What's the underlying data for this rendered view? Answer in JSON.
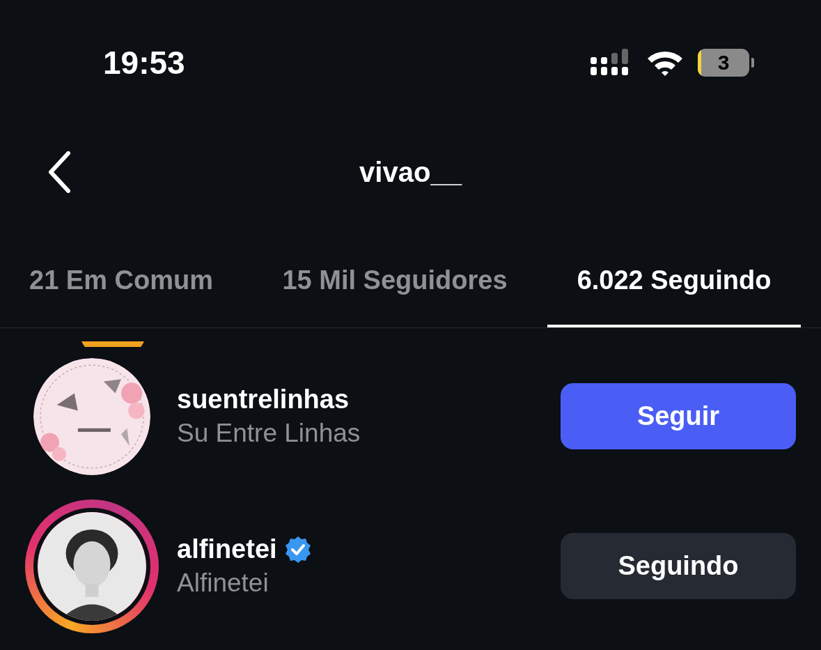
{
  "status_bar": {
    "time": "19:53",
    "battery": "3"
  },
  "header": {
    "title": "vivao__"
  },
  "tabs": [
    {
      "label": "21 Em Comum",
      "selected": false
    },
    {
      "label": "15 Mil Seguidores",
      "selected": false
    },
    {
      "label": "6.022 Seguindo",
      "selected": true
    }
  ],
  "accounts": [
    {
      "username": "suentrelinhas",
      "name": "Su Entre Linhas",
      "verified": false,
      "has_story": false,
      "following": false,
      "button": "Seguir",
      "kind": "picture"
    },
    {
      "username": "alfinetei",
      "name": "Alfinetei",
      "verified": true,
      "has_story": true,
      "following": true,
      "button": "Seguindo",
      "kind": "picture"
    }
  ]
}
